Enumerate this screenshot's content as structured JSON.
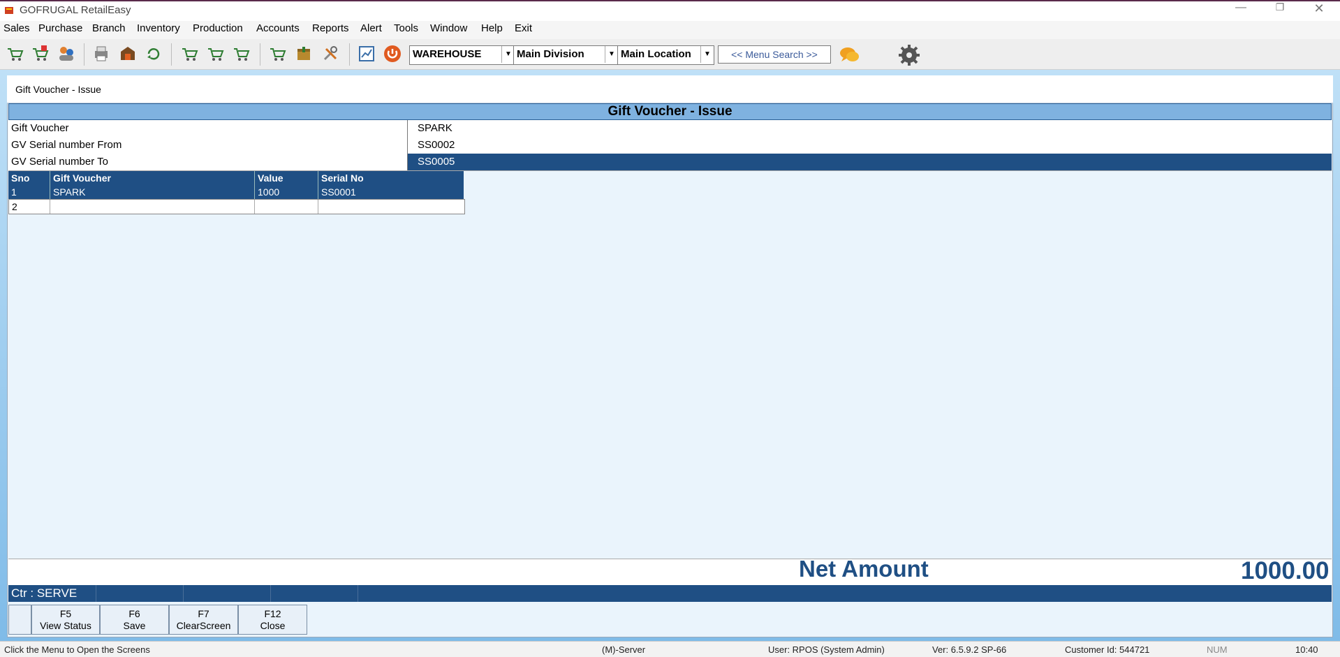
{
  "app": {
    "title": "GOFRUGAL RetailEasy",
    "window_controls": {
      "minimize": "—",
      "restore": "❐",
      "close": "✕"
    }
  },
  "menu": [
    "Sales",
    "Purchase",
    "Branch",
    "Inventory",
    "Production",
    "Accounts",
    "Reports",
    "Alert",
    "Tools",
    "Window",
    "Help",
    "Exit"
  ],
  "toolbar": {
    "icons": [
      "cart-icon",
      "cart-add-icon",
      "users-icon",
      "printer-icon",
      "shop-icon",
      "refresh-icon",
      "cart-in-icon",
      "cart-out-icon",
      "cart-return-icon",
      "cart-check-icon",
      "box-icon",
      "tools-icon",
      "report-icon",
      "power-icon"
    ],
    "warehouse": "WAREHOUSE",
    "division": "Main Division",
    "location": "Main Location",
    "menu_search": "<< Menu Search >>",
    "accent_power": "#e05a20"
  },
  "window": {
    "title": "Gift Voucher - Issue",
    "header": "Gift Voucher - Issue"
  },
  "form": {
    "rows": [
      {
        "label": "Gift Voucher",
        "value": "SPARK"
      },
      {
        "label": "GV Serial number From",
        "value": "SS0002"
      },
      {
        "label": "GV Serial number To",
        "value": "SS0005"
      }
    ]
  },
  "grid": {
    "columns": [
      "Sno",
      "Gift Voucher",
      "Value",
      "Serial No"
    ],
    "rows": [
      [
        "1",
        "SPARK",
        "1000",
        "SS0001"
      ],
      [
        "2",
        "",
        "",
        ""
      ]
    ]
  },
  "summary": {
    "label": "Net Amount",
    "value": "1000.00"
  },
  "counter": {
    "label": "Ctr : SERVE"
  },
  "function_keys": [
    {
      "key": "",
      "label": ""
    },
    {
      "key": "F5",
      "label": "View Status"
    },
    {
      "key": "F6",
      "label": "Save"
    },
    {
      "key": "F7",
      "label": "ClearScreen"
    },
    {
      "key": "F12",
      "label": "Close"
    }
  ],
  "statusbar": {
    "hint": "Click the Menu to Open the Screens",
    "server": "(M)-Server",
    "user": "User: RPOS (System Admin)",
    "version": "Ver: 6.5.9.2 SP-66",
    "customer": "Customer Id: 544721",
    "num": "NUM",
    "time": "10:40"
  },
  "colors": {
    "selection": "#1f4f84",
    "header": "#7fb2e0",
    "panel": "#eaf4fc"
  }
}
